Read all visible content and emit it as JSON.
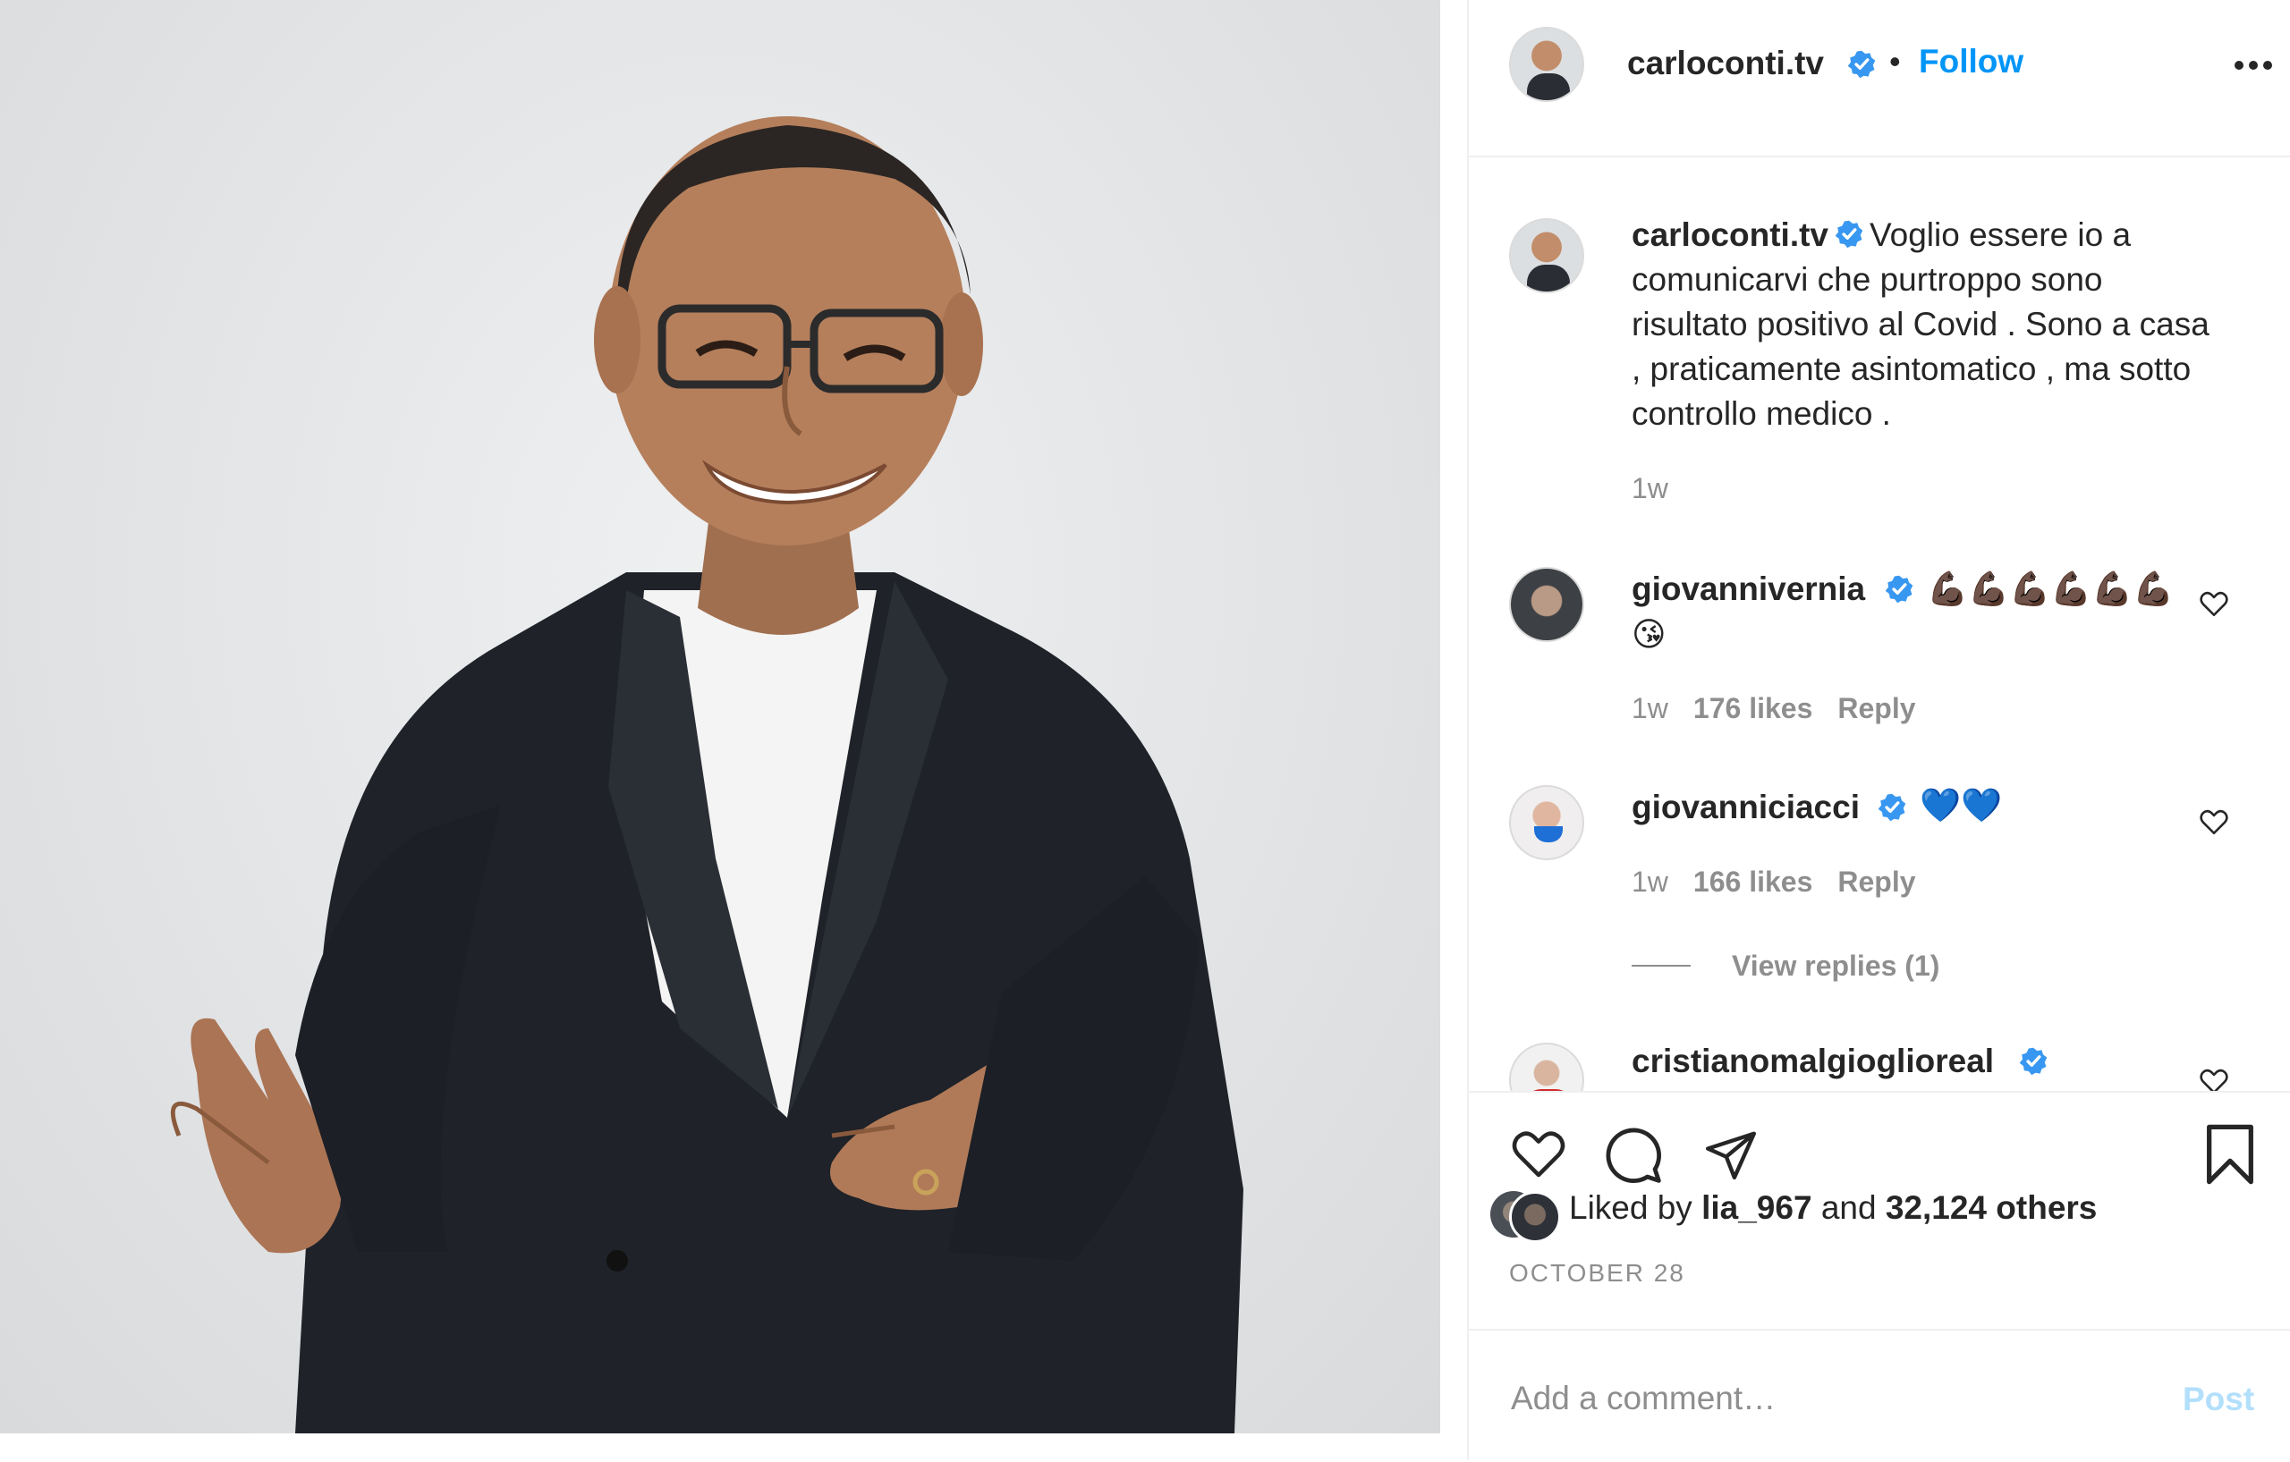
{
  "post": {
    "author": "carloconti.tv",
    "follow_label": "Follow",
    "separator": "•",
    "photo_alt": "carloconti.tv"
  },
  "caption": {
    "author": "carloconti.tv",
    "text": "Voglio essere io a comunicarvi che purtroppo sono risultato positivo al Covid . Sono a casa , praticamente asintomatico , ma sotto controllo medico .",
    "time": "1w"
  },
  "comments": [
    {
      "author": "giovannivernia",
      "text_line1": "💪🏿💪🏿💪🏿💪🏿💪🏿💪🏿",
      "text_line2": "😘",
      "time": "1w",
      "likes": "176 likes",
      "reply_label": "Reply"
    },
    {
      "author": "giovanniciacci",
      "text_line1": "💙💙",
      "time": "1w",
      "likes": "166 likes",
      "reply_label": "Reply",
      "view_replies": "View replies (1)"
    },
    {
      "author": "cristianomalgioglioreal"
    }
  ],
  "likes": {
    "prefix": "Liked by",
    "user": "lia_967",
    "conjunction": "and",
    "others": "32,124 others"
  },
  "date": "OCTOBER 28",
  "add_comment": {
    "placeholder": "Add a comment…",
    "post_label": "Post"
  },
  "colors": {
    "accent": "#0095f6",
    "verified": "#3897f0",
    "muted": "#8e8e8e",
    "post_disabled": "#b2dffc"
  },
  "icons": [
    "more-icon",
    "verified-icon",
    "heart-icon",
    "comment-icon",
    "share-icon",
    "bookmark-icon"
  ]
}
